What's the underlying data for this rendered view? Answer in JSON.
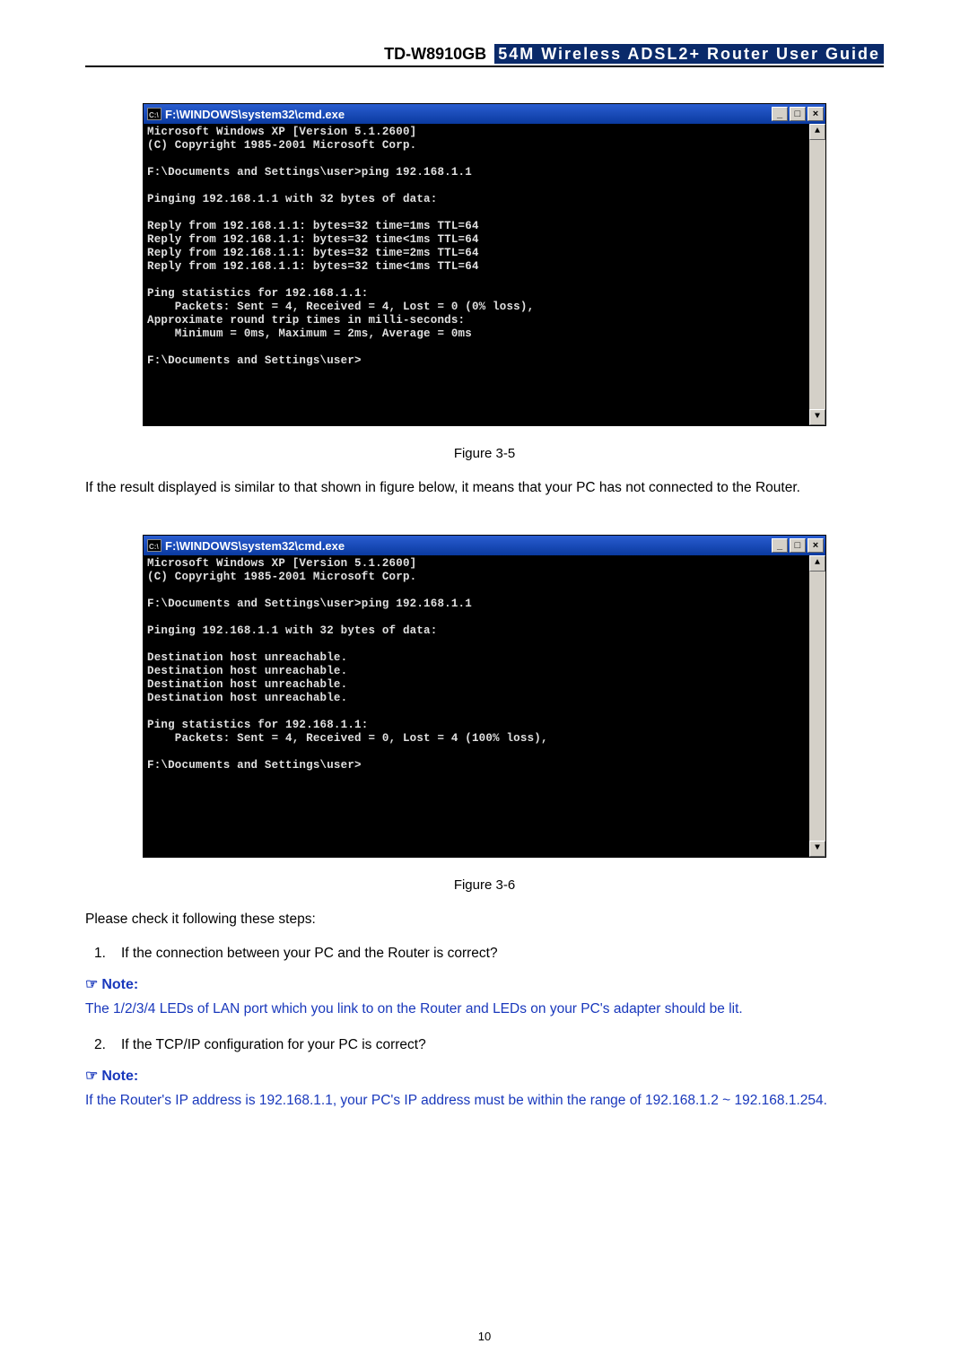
{
  "header": {
    "model": "TD-W8910GB",
    "description": "54M Wireless ADSL2+ Router User Guide"
  },
  "cmd1": {
    "title_icon": "C:\\",
    "title": "F:\\WINDOWS\\system32\\cmd.exe",
    "min_btn": "_",
    "max_btn": "□",
    "close_btn": "×",
    "scroll_up": "▲",
    "scroll_down": "▼",
    "lines_text": "Microsoft Windows XP [Version 5.1.2600]\n(C) Copyright 1985-2001 Microsoft Corp.\n\nF:\\Documents and Settings\\user>ping 192.168.1.1\n\nPinging 192.168.1.1 with 32 bytes of data:\n\nReply from 192.168.1.1: bytes=32 time=1ms TTL=64\nReply from 192.168.1.1: bytes=32 time<1ms TTL=64\nReply from 192.168.1.1: bytes=32 time=2ms TTL=64\nReply from 192.168.1.1: bytes=32 time<1ms TTL=64\n\nPing statistics for 192.168.1.1:\n    Packets: Sent = 4, Received = 4, Lost = 0 (0% loss),\nApproximate round trip times in milli-seconds:\n    Minimum = 0ms, Maximum = 2ms, Average = 0ms\n\nF:\\Documents and Settings\\user>\n\n\n\n\n"
  },
  "fig1_caption": "Figure 3-5",
  "para1": "If the result displayed is similar to that shown in figure below, it means that your PC has not connected to the Router.",
  "cmd2": {
    "title_icon": "C:\\",
    "title": "F:\\WINDOWS\\system32\\cmd.exe",
    "min_btn": "_",
    "max_btn": "□",
    "close_btn": "×",
    "scroll_up": "▲",
    "scroll_down": "▼",
    "lines_text": "Microsoft Windows XP [Version 5.1.2600]\n(C) Copyright 1985-2001 Microsoft Corp.\n\nF:\\Documents and Settings\\user>ping 192.168.1.1\n\nPinging 192.168.1.1 with 32 bytes of data:\n\nDestination host unreachable.\nDestination host unreachable.\nDestination host unreachable.\nDestination host unreachable.\n\nPing statistics for 192.168.1.1:\n    Packets: Sent = 4, Received = 0, Lost = 4 (100% loss),\n\nF:\\Documents and Settings\\user>\n\n\n\n\n\n\n"
  },
  "fig2_caption": "Figure 3-6",
  "para2": "Please check it following these steps:",
  "step1_num": "1.",
  "step1": "If the connection between your PC and the Router is correct?",
  "note_label": "Note:",
  "note_hand": "☞",
  "note1_text": "The 1/2/3/4 LEDs of LAN port which you link to on the Router and LEDs on your PC's adapter should be lit.",
  "step2_num": "2.",
  "step2": "If the TCP/IP configuration for your PC is correct?",
  "note2_text": "If the Router's IP address is 192.168.1.1, your PC's IP address must be within the range of 192.168.1.2 ~ 192.168.1.254.",
  "page_number": "10"
}
